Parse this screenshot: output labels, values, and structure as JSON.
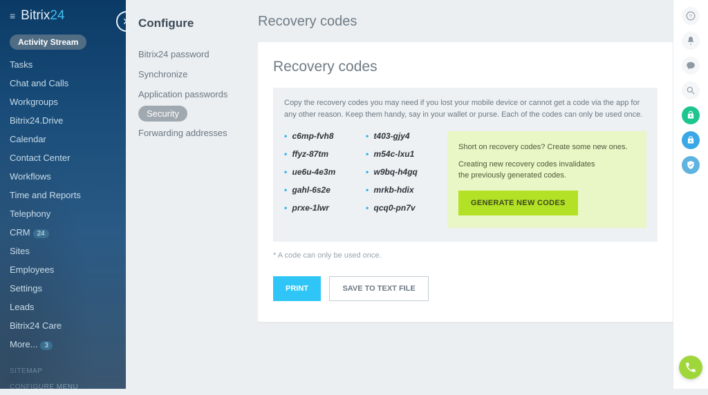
{
  "brand": {
    "text1": "Bitrix",
    "text2": "24"
  },
  "sidebar": {
    "pill": "Activity Stream",
    "items": [
      {
        "label": "Tasks"
      },
      {
        "label": "Chat and Calls"
      },
      {
        "label": "Workgroups"
      },
      {
        "label": "Bitrix24.Drive"
      },
      {
        "label": "Calendar"
      },
      {
        "label": "Contact Center"
      },
      {
        "label": "Workflows"
      },
      {
        "label": "Time and Reports"
      },
      {
        "label": "Telephony"
      },
      {
        "label": "CRM",
        "badge": "24"
      },
      {
        "label": "Sites"
      },
      {
        "label": "Employees"
      },
      {
        "label": "Settings"
      },
      {
        "label": "Leads"
      },
      {
        "label": "Bitrix24 Care"
      },
      {
        "label": "More...",
        "badge": "3"
      }
    ],
    "footer": [
      "SITEMAP",
      "CONFIGURE MENU"
    ]
  },
  "config": {
    "title": "Configure",
    "items": [
      {
        "label": "Bitrix24 password"
      },
      {
        "label": "Synchronize"
      },
      {
        "label": "Application passwords"
      },
      {
        "label": "Security",
        "active": true
      },
      {
        "label": "Forwarding addresses"
      }
    ]
  },
  "main": {
    "page_title": "Recovery codes",
    "card_title": "Recovery codes",
    "hint": "Copy the recovery codes you may need if you lost your mobile device or cannot get a code via the app for any other reason. Keep them handy, say in your wallet or purse. Each of the codes can only be used once.",
    "codes_left": [
      "c6mp-fvh8",
      "ffyz-87tm",
      "ue6u-4e3m",
      "gahl-6s2e",
      "prxe-1lwr"
    ],
    "codes_right": [
      "t403-gjy4",
      "m54c-lxu1",
      "w9bq-h4gq",
      "mrkb-hdix",
      "qcq0-pn7v"
    ],
    "gen_panel": {
      "line1": "Short on recovery codes? Create some new ones.",
      "line2a": "Creating new recovery codes invalidates",
      "line2b": "the previously generated codes.",
      "button": "GENERATE NEW CODES"
    },
    "note": "* A code can only be used once.",
    "print": "PRINT",
    "save": "SAVE TO TEXT FILE"
  }
}
